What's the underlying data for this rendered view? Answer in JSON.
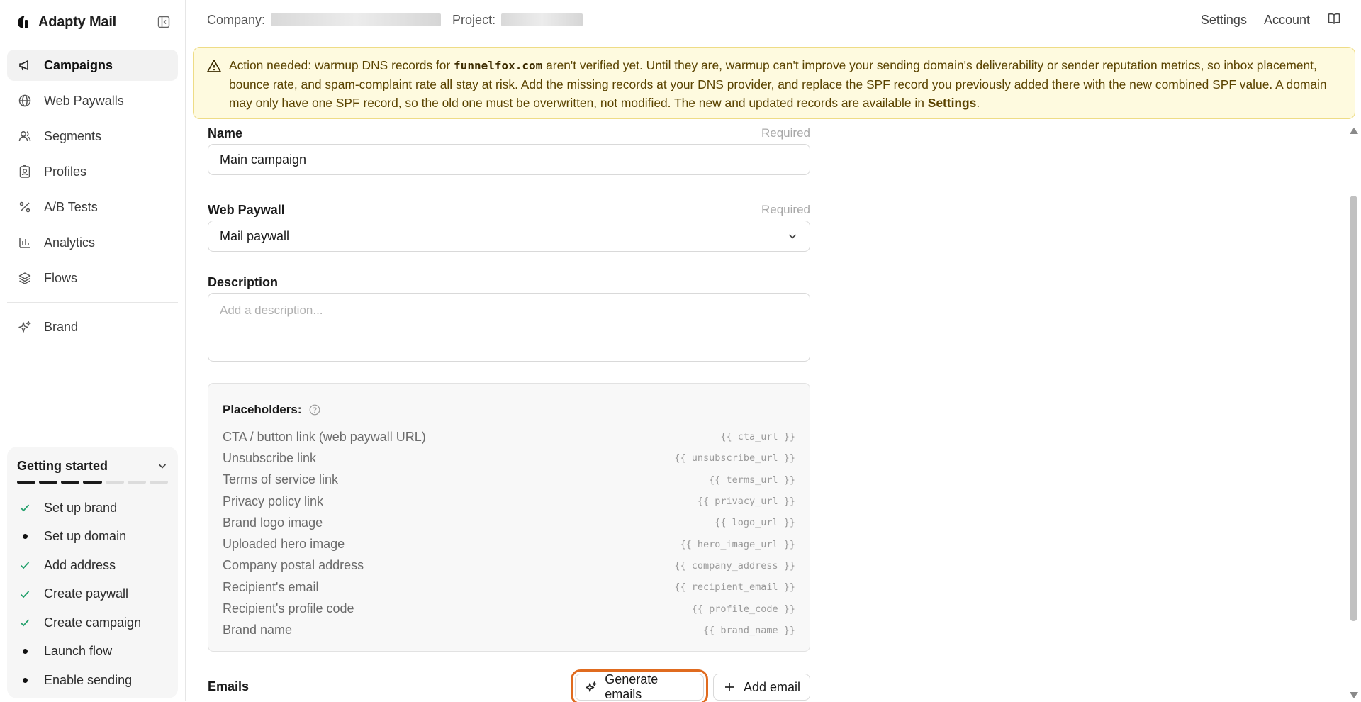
{
  "app": {
    "name": "Adapty Mail"
  },
  "sidebar": {
    "items": [
      {
        "label": "Campaigns",
        "icon": "megaphone-icon",
        "active": true
      },
      {
        "label": "Web Paywalls",
        "icon": "globe-icon"
      },
      {
        "label": "Segments",
        "icon": "users-icon"
      },
      {
        "label": "Profiles",
        "icon": "id-badge-icon"
      },
      {
        "label": "A/B Tests",
        "icon": "percent-icon"
      },
      {
        "label": "Analytics",
        "icon": "bar-chart-icon"
      },
      {
        "label": "Flows",
        "icon": "layers-icon"
      }
    ],
    "brand_item": {
      "label": "Brand",
      "icon": "sparkles-icon"
    },
    "getting_started": {
      "title": "Getting started",
      "progress": {
        "completed": 4,
        "total": 7
      },
      "steps": [
        {
          "label": "Set up brand",
          "done": true
        },
        {
          "label": "Set up domain",
          "done": false
        },
        {
          "label": "Add address",
          "done": true
        },
        {
          "label": "Create paywall",
          "done": true
        },
        {
          "label": "Create campaign",
          "done": true
        },
        {
          "label": "Launch flow",
          "done": false
        },
        {
          "label": "Enable sending",
          "done": false
        }
      ]
    }
  },
  "topbar": {
    "company_label": "Company:",
    "project_label": "Project:",
    "settings_label": "Settings",
    "account_label": "Account"
  },
  "alert": {
    "prefix": "Action needed: warmup DNS records for ",
    "domain": "funnelfox.com",
    "body": " aren't verified yet. Until they are, warmup can't improve your sending domain's deliverability or sender reputation metrics, so inbox placement, bounce rate, and spam-complaint rate all stay at risk. Add the missing records at your DNS provider, and replace the SPF record you previously added there with the new combined SPF value. A domain may only have one SPF record, so the old one must be overwritten, not modified. The new and updated records are available in ",
    "link": "Settings",
    "suffix": "."
  },
  "form": {
    "name": {
      "label": "Name",
      "required": "Required",
      "value": "Main campaign"
    },
    "paywall": {
      "label": "Web Paywall",
      "required": "Required",
      "value": "Mail paywall"
    },
    "description": {
      "label": "Description",
      "placeholder": "Add a description..."
    },
    "placeholders": {
      "title": "Placeholders:",
      "rows": [
        {
          "name": "CTA / button link (web paywall URL)",
          "code": "{{ cta_url }}"
        },
        {
          "name": "Unsubscribe link",
          "code": "{{ unsubscribe_url }}"
        },
        {
          "name": "Terms of service link",
          "code": "{{ terms_url }}"
        },
        {
          "name": "Privacy policy link",
          "code": "{{ privacy_url }}"
        },
        {
          "name": "Brand logo image",
          "code": "{{ logo_url }}"
        },
        {
          "name": "Uploaded hero image",
          "code": "{{ hero_image_url }}"
        },
        {
          "name": "Company postal address",
          "code": "{{ company_address }}"
        },
        {
          "name": "Recipient's email",
          "code": "{{ recipient_email }}"
        },
        {
          "name": "Recipient's profile code",
          "code": "{{ profile_code }}"
        },
        {
          "name": "Brand name",
          "code": "{{ brand_name }}"
        }
      ]
    },
    "emails": {
      "label": "Emails",
      "generate_label": "Generate emails",
      "add_label": "Add email"
    }
  },
  "colors": {
    "alert_bg": "#fefadf",
    "alert_border": "#eedc86",
    "highlight": "#e06b1f",
    "check": "#22a06b"
  }
}
